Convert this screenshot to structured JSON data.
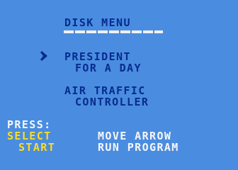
{
  "menu": {
    "title": "DISK MENU",
    "items": [
      {
        "line1": "PRESIDENT",
        "line2": "FOR A DAY"
      },
      {
        "line1": "AIR TRAFFIC",
        "line2": "CONTROLLER"
      }
    ],
    "cursor_icon": "selection-arrow-icon"
  },
  "instructions": {
    "press_label": "PRESS:",
    "select_key": "SELECT",
    "select_action": "MOVE ARROW",
    "start_key": "START",
    "start_action": "RUN PROGRAM"
  },
  "colors": {
    "background": "#4a8de0",
    "menu_text": "#072b8f",
    "instruction_text": "#f7f7f7",
    "key_text": "#fcdc22"
  }
}
